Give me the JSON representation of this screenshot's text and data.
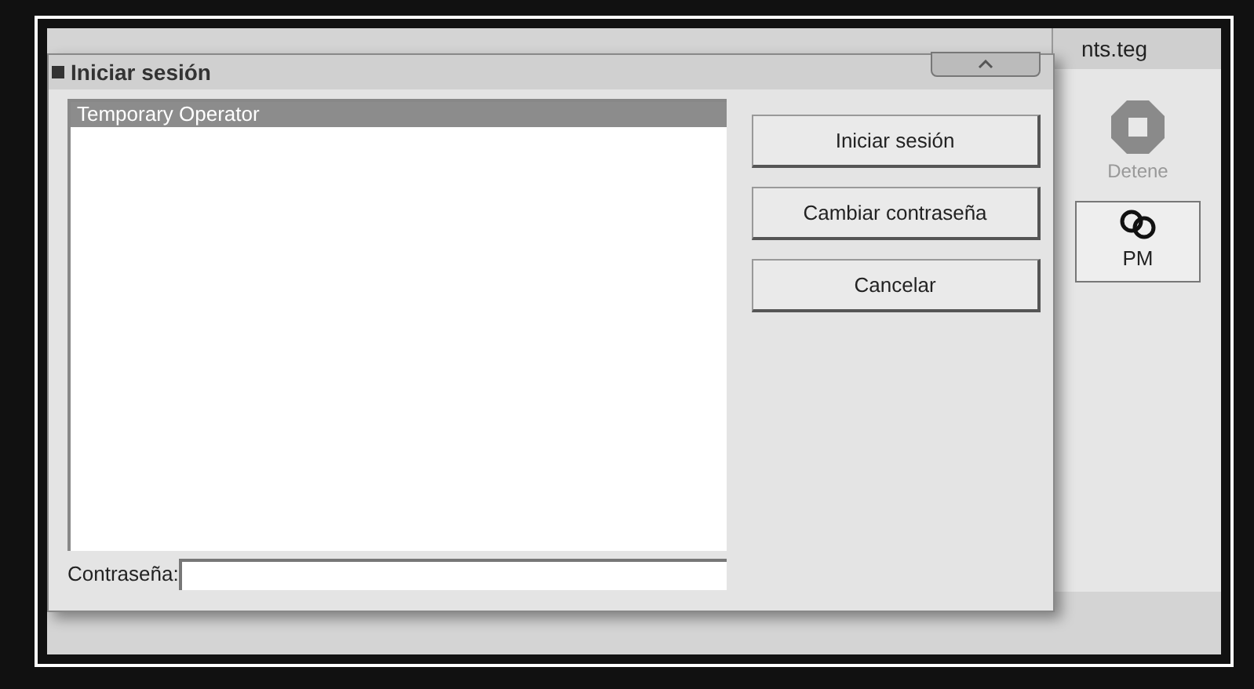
{
  "background_window": {
    "title": "nts.teg",
    "toolbar": [
      {
        "kind": "stop",
        "label": "Detene"
      },
      {
        "kind": "pm",
        "label": "PM"
      }
    ]
  },
  "dialog": {
    "title": "Iniciar sesión",
    "users": [
      {
        "name": "Temporary Operator",
        "selected": true
      }
    ],
    "buttons": [
      "Iniciar sesión",
      "Cambiar contraseña",
      "Cancelar"
    ],
    "password": {
      "label": "Contraseña:"
    }
  }
}
